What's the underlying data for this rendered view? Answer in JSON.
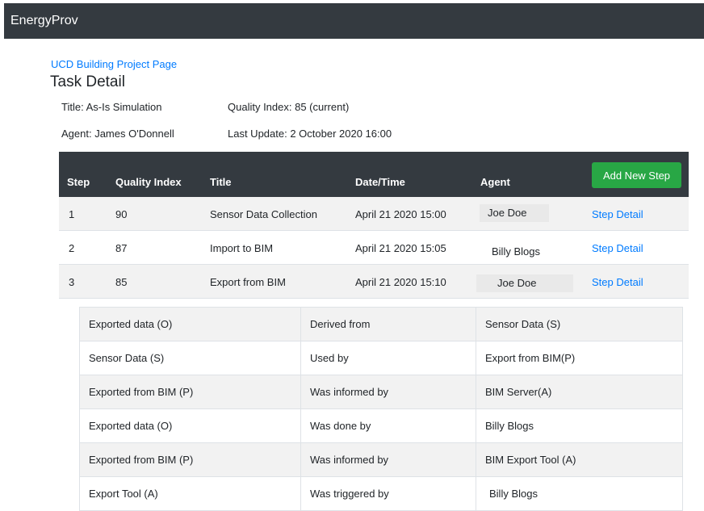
{
  "navbar": {
    "brand": "EnergyProv"
  },
  "breadcrumb": {
    "project_link": "UCD Building Project Page"
  },
  "page": {
    "title": "Task Detail"
  },
  "task": {
    "title": "Title: As-Is Simulation",
    "quality": "Quality Index: 85 (current)",
    "agent": "Agent: James O'Donnell",
    "last_update": "Last Update: 2 October 2020 16:00"
  },
  "steps_table": {
    "headers": [
      "Step",
      "Quality Index",
      "Title",
      "Date/Time",
      "Agent"
    ],
    "add_button": "Add New Step",
    "rows": [
      {
        "step": "1",
        "quality": "90",
        "title": "Sensor Data Collection",
        "datetime": "April 21 2020 15:00",
        "agent": "Joe Doe",
        "link": "Step Detail"
      },
      {
        "step": "2",
        "quality": "87",
        "title": "Import to BIM",
        "datetime": "April 21 2020 15:05",
        "agent": "Billy Blogs",
        "link": "Step Detail"
      },
      {
        "step": "3",
        "quality": "85",
        "title": "Export from BIM",
        "datetime": "April 21 2020 15:10",
        "agent": "Joe Doe",
        "link": "Step Detail"
      }
    ]
  },
  "provenance": [
    [
      "Exported data (O)",
      "Derived from",
      "Sensor Data (S)"
    ],
    [
      "Sensor Data (S)",
      "Used by",
      "Export from BIM(P)"
    ],
    [
      "Exported from BIM (P)",
      "Was informed by",
      "BIM Server(A)"
    ],
    [
      "Exported data (O)",
      "Was done by",
      "Billy Blogs"
    ],
    [
      "Exported from BIM (P)",
      "Was informed by",
      "BIM Export Tool (A)"
    ],
    [
      "Export Tool (A)",
      "Was triggered by",
      "Billy Blogs"
    ]
  ],
  "colors": {
    "navbar": "#343a40",
    "link": "#007bff",
    "add_button": "#28a745",
    "stripe": "#f2f2f2"
  }
}
